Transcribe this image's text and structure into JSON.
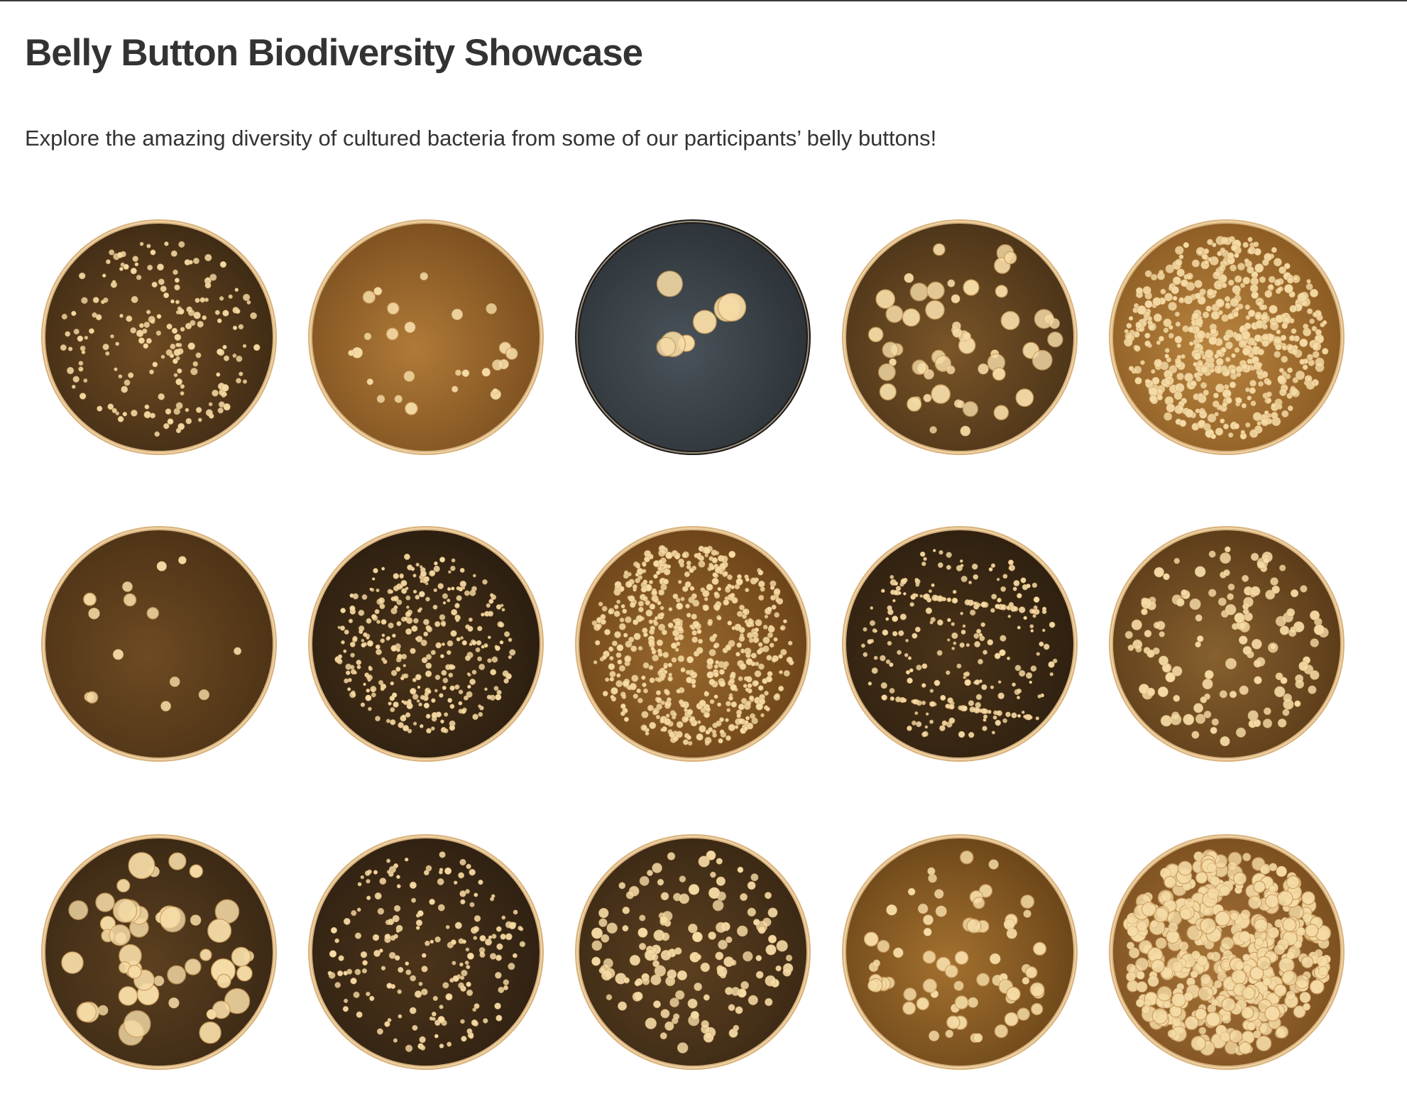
{
  "page": {
    "title": "Belly Button Biodiversity Showcase",
    "subtitle": "Explore the amazing diversity of cultured bacteria from some of our participants’ belly buttons!"
  },
  "colors": {
    "rim": "#d9b17a",
    "colony": "#f5dba6",
    "colony_edge": "#c8995a",
    "text": "#333333"
  },
  "plates": [
    {
      "name": "plate-1",
      "bg": "#3d2a14",
      "glow": "#6e4a22",
      "style": "tiny-scatter"
    },
    {
      "name": "plate-2",
      "bg": "#7a4e1e",
      "glow": "#b07a38",
      "style": "sparse-small"
    },
    {
      "name": "plate-3",
      "bg": "#2c3237",
      "glow": "#4a535a",
      "style": "few-large",
      "rim": "#1d1a18"
    },
    {
      "name": "plate-4",
      "bg": "#4a3318",
      "glow": "#7a5528",
      "style": "medium-arc"
    },
    {
      "name": "plate-5",
      "bg": "#8a5a22",
      "glow": "#b98540",
      "style": "dense"
    },
    {
      "name": "plate-6",
      "bg": "#4c3216",
      "glow": "#6d4a22",
      "style": "very-sparse"
    },
    {
      "name": "plate-7",
      "bg": "#2a1d10",
      "glow": "#4a3318",
      "style": "cluster-streak"
    },
    {
      "name": "plate-8",
      "bg": "#6a4218",
      "glow": "#9a6a2e",
      "style": "dense-streak"
    },
    {
      "name": "plate-9",
      "bg": "#2d1f10",
      "glow": "#4a3318",
      "style": "lines"
    },
    {
      "name": "plate-10",
      "bg": "#5a3a18",
      "glow": "#86602e",
      "style": "medium-scatter"
    },
    {
      "name": "plate-11",
      "bg": "#3a2814",
      "glow": "#5c4020",
      "style": "flower-large"
    },
    {
      "name": "plate-12",
      "bg": "#2e2012",
      "glow": "#4c341a",
      "style": "tiny-scatter"
    },
    {
      "name": "plate-13",
      "bg": "#3a2814",
      "glow": "#5c4020",
      "style": "medium-scatter"
    },
    {
      "name": "plate-14",
      "bg": "#6a4418",
      "glow": "#a3712f",
      "style": "sparse-medium"
    },
    {
      "name": "plate-15",
      "bg": "#7a4e1e",
      "glow": "#a6743a",
      "style": "dense-large"
    }
  ]
}
